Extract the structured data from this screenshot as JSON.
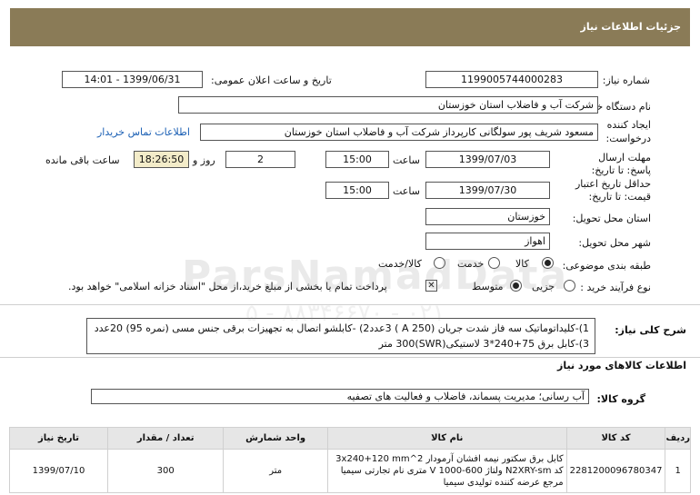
{
  "header": {
    "title": "جزئیات اطلاعات نیاز"
  },
  "form": {
    "need_number_label": "شماره نیاز:",
    "need_number": "1199005744000283",
    "announce_label": "تاریخ و ساعت اعلان عمومی:",
    "announce_value": "1399/06/31 - 14:01",
    "buyer_label": "نام دستگاه خریدار:",
    "buyer_value": "شرکت آب و فاضلاب استان خوزستان",
    "creator_label": "ایجاد کننده درخواست:",
    "creator_value": "مسعود شریف پور سولگانی کارپرداز شرکت آب و فاضلاب استان خوزستان",
    "contact_link": "اطلاعات تماس خریدار",
    "deadline_label": "مهلت ارسال پاسخ: تا تاریخ:",
    "deadline_date": "1399/07/03",
    "time_word": "ساعت",
    "deadline_time": "15:00",
    "days_value": "2",
    "days_word": "روز و",
    "remaining_time": "18:26:50",
    "remaining_word": "ساعت باقی مانده",
    "validity_label": "حداقل تاریخ اعتبار قیمت: تا تاریخ:",
    "validity_date": "1399/07/30",
    "validity_time": "15:00",
    "province_label": "استان محل تحویل:",
    "province_value": "خوزستان",
    "city_label": "شهر محل تحویل:",
    "city_value": "اهواز",
    "category_label": "طبقه بندی موضوعی:",
    "category_options": [
      "کالا",
      "خدمت",
      "کالا/خدمت"
    ],
    "process_label": "نوع فرآیند خرید :",
    "process_options": [
      "جزیی",
      "متوسط"
    ],
    "payment_note": "پرداخت تمام یا بخشی از مبلغ خرید،از محل \"اسناد خزانه اسلامی\" خواهد بود.",
    "desc_label": "شرح کلی نیاز:",
    "desc_text": "1)-کلیداتوماتیک سه فاز شدت جریان (250 A ) 3عدد2) -کابلشو اتصال به تجهیزات برقی جنس مسی (نمره 95) 20عدد 3)-کابل برق 75+240*3 لاستیکی(SWR)300 متر"
  },
  "goods": {
    "section_title": "اطلاعات کالاهای مورد نیاز",
    "group_label": "گروه کالا:",
    "group_value": "آب رسانی؛ مدیریت پسماند، فاضلاب و فعالیت های تصفیه"
  },
  "table": {
    "headers": [
      "ردیف",
      "کد کالا",
      "نام کالا",
      "واحد شمارش",
      "تعداد / مقدار",
      "تاریخ نیاز"
    ],
    "rows": [
      {
        "idx": "1",
        "code": "2281200096780347",
        "name": "کابل برق سکتور نیمه افشان آرمودار 3x240+120 mm^2 کد N2XRY-sm ولتاژ 600-1000 V متری نام تجارتی سیمیا مرجع عرضه کننده تولیدی سیمیا",
        "unit": "متر",
        "qty": "300",
        "date": "1399/07/10"
      }
    ]
  },
  "watermark": {
    "brand": "ParsNamadData",
    "phone": "۰۲۱ - ۸۸۳۴۶۶۷۰ - ۵"
  }
}
